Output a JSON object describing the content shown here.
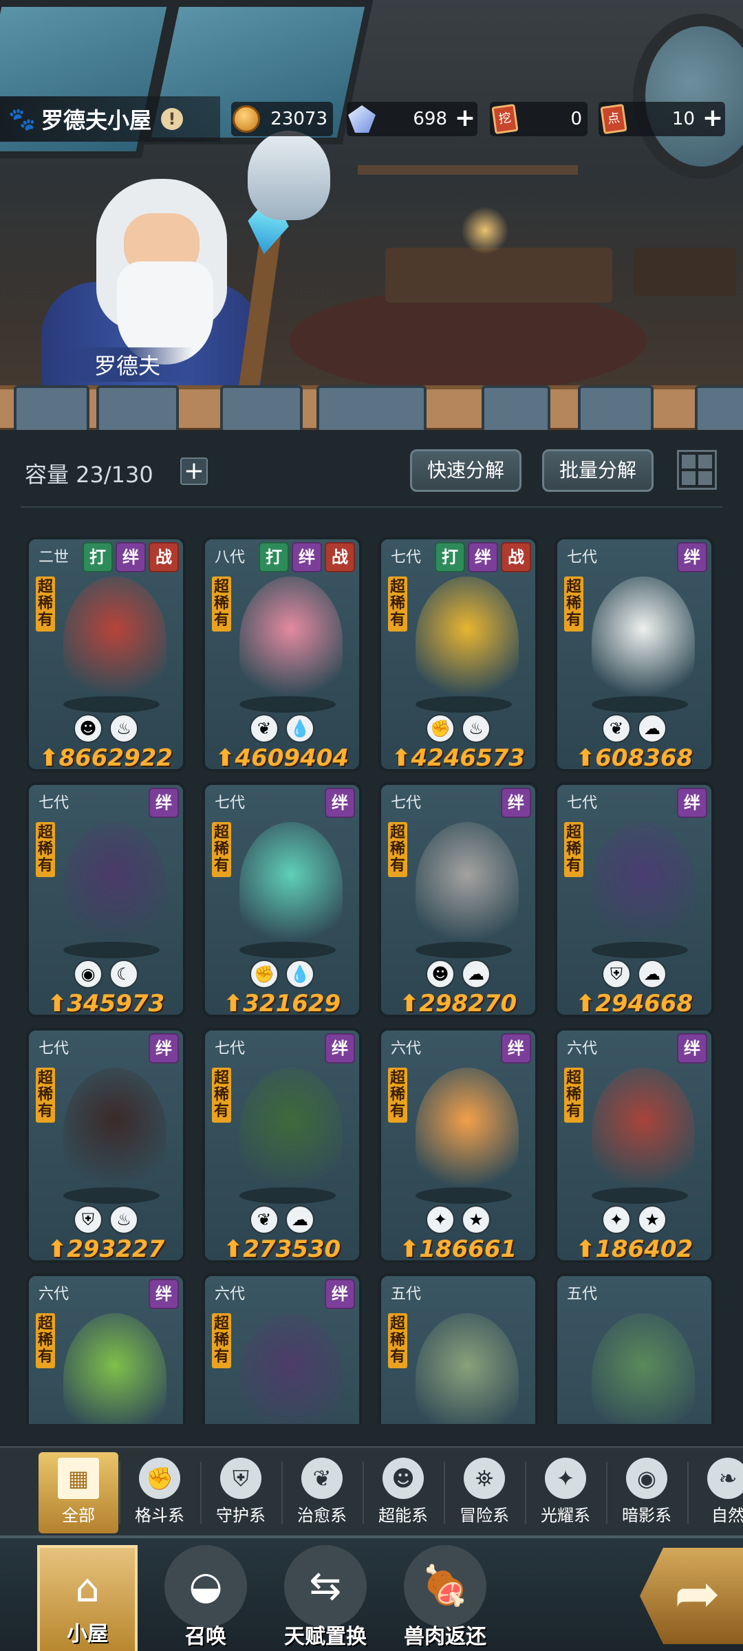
{
  "header": {
    "location": "罗德夫小屋",
    "npc_name": "罗德夫",
    "resources": [
      {
        "icon": "gold-coin-icon",
        "value": "23073",
        "has_plus": false
      },
      {
        "icon": "diamond-icon",
        "value": "698",
        "has_plus": true
      },
      {
        "icon": "dig-ticket-icon",
        "ticket_char": "挖",
        "value": "0",
        "has_plus": false
      },
      {
        "icon": "point-ticket-icon",
        "ticket_char": "点",
        "value": "10",
        "has_plus": true
      }
    ]
  },
  "storage": {
    "capacity_label": "容量 23/130",
    "quick_decompose": "快速分解",
    "batch_decompose": "批量分解"
  },
  "pets": [
    {
      "gen": "二世",
      "tags": [
        "打",
        "绊",
        "战"
      ],
      "rarity": "超稀有",
      "attrs": [
        "superpower",
        "fire"
      ],
      "power": "8662922",
      "art_color": "#b8443a"
    },
    {
      "gen": "八代",
      "tags": [
        "打",
        "绊",
        "战"
      ],
      "rarity": "超稀有",
      "attrs": [
        "heal-leaf",
        "water"
      ],
      "power": "4609404",
      "art_color": "#e48aa0"
    },
    {
      "gen": "七代",
      "tags": [
        "打",
        "绊",
        "战"
      ],
      "rarity": "超稀有",
      "attrs": [
        "fight",
        "fire"
      ],
      "power": "4246573",
      "art_color": "#e8b531"
    },
    {
      "gen": "七代",
      "tags": [
        "绊"
      ],
      "rarity": "超稀有",
      "attrs": [
        "heal",
        "adventure"
      ],
      "power": "608368",
      "art_color": "#eef0ee"
    },
    {
      "gen": "七代",
      "tags": [
        "绊"
      ],
      "rarity": "超稀有",
      "attrs": [
        "shadow",
        "dark"
      ],
      "power": "345973",
      "art_color": "#4b3a6a"
    },
    {
      "gen": "七代",
      "tags": [
        "绊"
      ],
      "rarity": "超稀有",
      "attrs": [
        "fight",
        "water"
      ],
      "power": "321629",
      "art_color": "#5fd0b8"
    },
    {
      "gen": "七代",
      "tags": [
        "绊"
      ],
      "rarity": "超稀有",
      "attrs": [
        "superpower",
        "adventure"
      ],
      "power": "298270",
      "art_color": "#a5a2a0"
    },
    {
      "gen": "七代",
      "tags": [
        "绊"
      ],
      "rarity": "超稀有",
      "attrs": [
        "guard",
        "adventure"
      ],
      "power": "294668",
      "art_color": "#4a3d72"
    },
    {
      "gen": "七代",
      "tags": [
        "绊"
      ],
      "rarity": "超稀有",
      "attrs": [
        "guard",
        "fire"
      ],
      "power": "293227",
      "art_color": "#3b2a2a"
    },
    {
      "gen": "七代",
      "tags": [
        "绊"
      ],
      "rarity": "超稀有",
      "attrs": [
        "heal",
        "adventure"
      ],
      "power": "273530",
      "art_color": "#3f6a3a"
    },
    {
      "gen": "六代",
      "tags": [
        "绊"
      ],
      "rarity": "超稀有",
      "attrs": [
        "light",
        "star"
      ],
      "power": "186661",
      "art_color": "#f2a04a"
    },
    {
      "gen": "六代",
      "tags": [
        "绊"
      ],
      "rarity": "超稀有",
      "attrs": [
        "light",
        "star"
      ],
      "power": "186402",
      "art_color": "#a8443a"
    },
    {
      "gen": "六代",
      "tags": [
        "绊"
      ],
      "rarity": "超稀有",
      "attrs": [],
      "power": "",
      "art_color": "#7fc04a"
    },
    {
      "gen": "六代",
      "tags": [
        "绊"
      ],
      "rarity": "超稀有",
      "attrs": [],
      "power": "",
      "art_color": "#4d3c6a"
    },
    {
      "gen": "五代",
      "tags": [],
      "rarity": "超稀有",
      "attrs": [],
      "power": "",
      "art_color": "#8aa07a"
    },
    {
      "gen": "五代",
      "tags": [],
      "rarity": "",
      "attrs": [],
      "power": "",
      "art_color": "#5a8a5a"
    }
  ],
  "categories": [
    {
      "label": "全部",
      "icon": "all-blocks-icon",
      "glyph": "▦",
      "active": true
    },
    {
      "label": "格斗系",
      "icon": "fist-icon",
      "glyph": "✊",
      "active": false
    },
    {
      "label": "守护系",
      "icon": "shield-icon",
      "glyph": "⛨",
      "active": false
    },
    {
      "label": "治愈系",
      "icon": "sprout-icon",
      "glyph": "❦",
      "active": false
    },
    {
      "label": "超能系",
      "icon": "alien-icon",
      "glyph": "☻",
      "active": false
    },
    {
      "label": "冒险系",
      "icon": "lantern-icon",
      "glyph": "⛯",
      "active": false
    },
    {
      "label": "光耀系",
      "icon": "light-star-icon",
      "glyph": "✦",
      "active": false
    },
    {
      "label": "暗影系",
      "icon": "shadow-eye-icon",
      "glyph": "◉",
      "active": false
    },
    {
      "label": "自然",
      "icon": "leaf-icon",
      "glyph": "❧",
      "active": false
    }
  ],
  "nav": [
    {
      "label": "小屋",
      "icon": "house-icon",
      "glyph": "⌂",
      "active": true
    },
    {
      "label": "召唤",
      "icon": "egg-icon",
      "glyph": "◒",
      "active": false
    },
    {
      "label": "天赋置换",
      "icon": "swap-icon",
      "glyph": "⇆",
      "active": false
    },
    {
      "label": "兽肉返还",
      "icon": "meat-icon",
      "glyph": "🍖",
      "active": false
    }
  ],
  "colors": {
    "accent_gold": "#e9c56a",
    "power_text": "#ffb02e",
    "rarity_badge": "#e9a320"
  }
}
